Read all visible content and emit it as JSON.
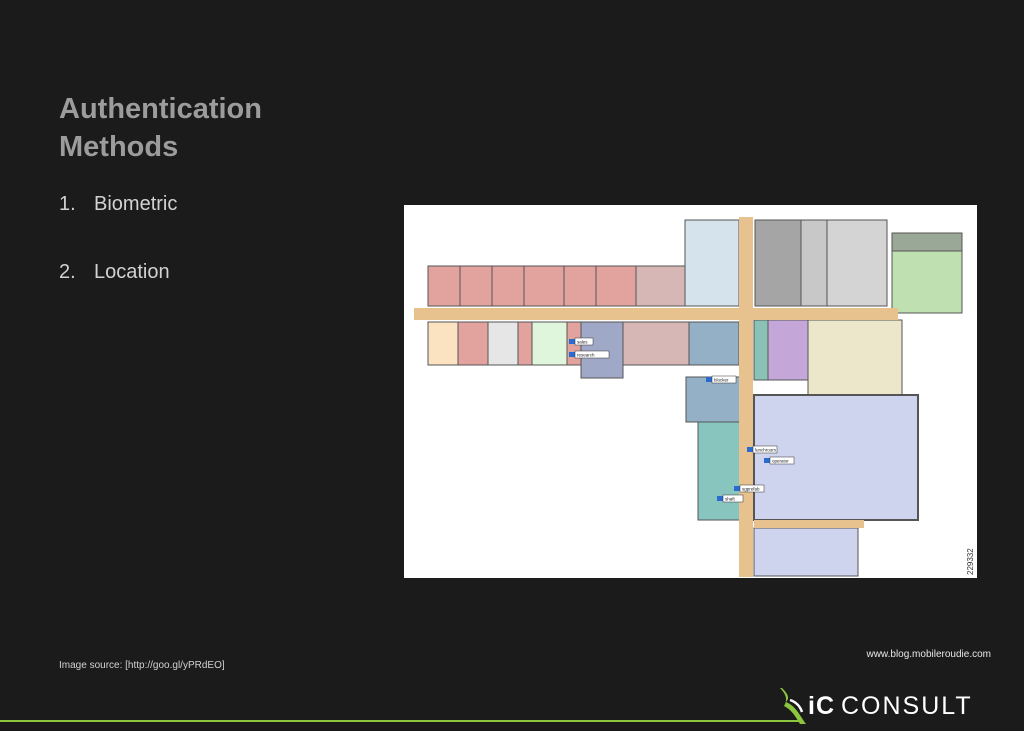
{
  "slide": {
    "title_line1": "Authentication",
    "title_line2": "Methods",
    "list": [
      {
        "num": "1.",
        "label": "Biometric"
      },
      {
        "num": "2.",
        "label": "Location"
      }
    ],
    "caption": "Image source: [http://goo.gl/yPRdEO]",
    "url": "www.blog.mobileroudie.com"
  },
  "floorplan": {
    "image_id_label": "229332",
    "room_tags": [
      "sales",
      "research",
      "blocker",
      "lunchroom",
      "operator",
      "sgprefab",
      "shaft"
    ]
  },
  "logo": {
    "part1": "iC",
    "part2": "CONSULT"
  },
  "colors": {
    "background": "#1b1b1c",
    "title": "#9c9c9c",
    "accent_green": "#8cc63e"
  }
}
